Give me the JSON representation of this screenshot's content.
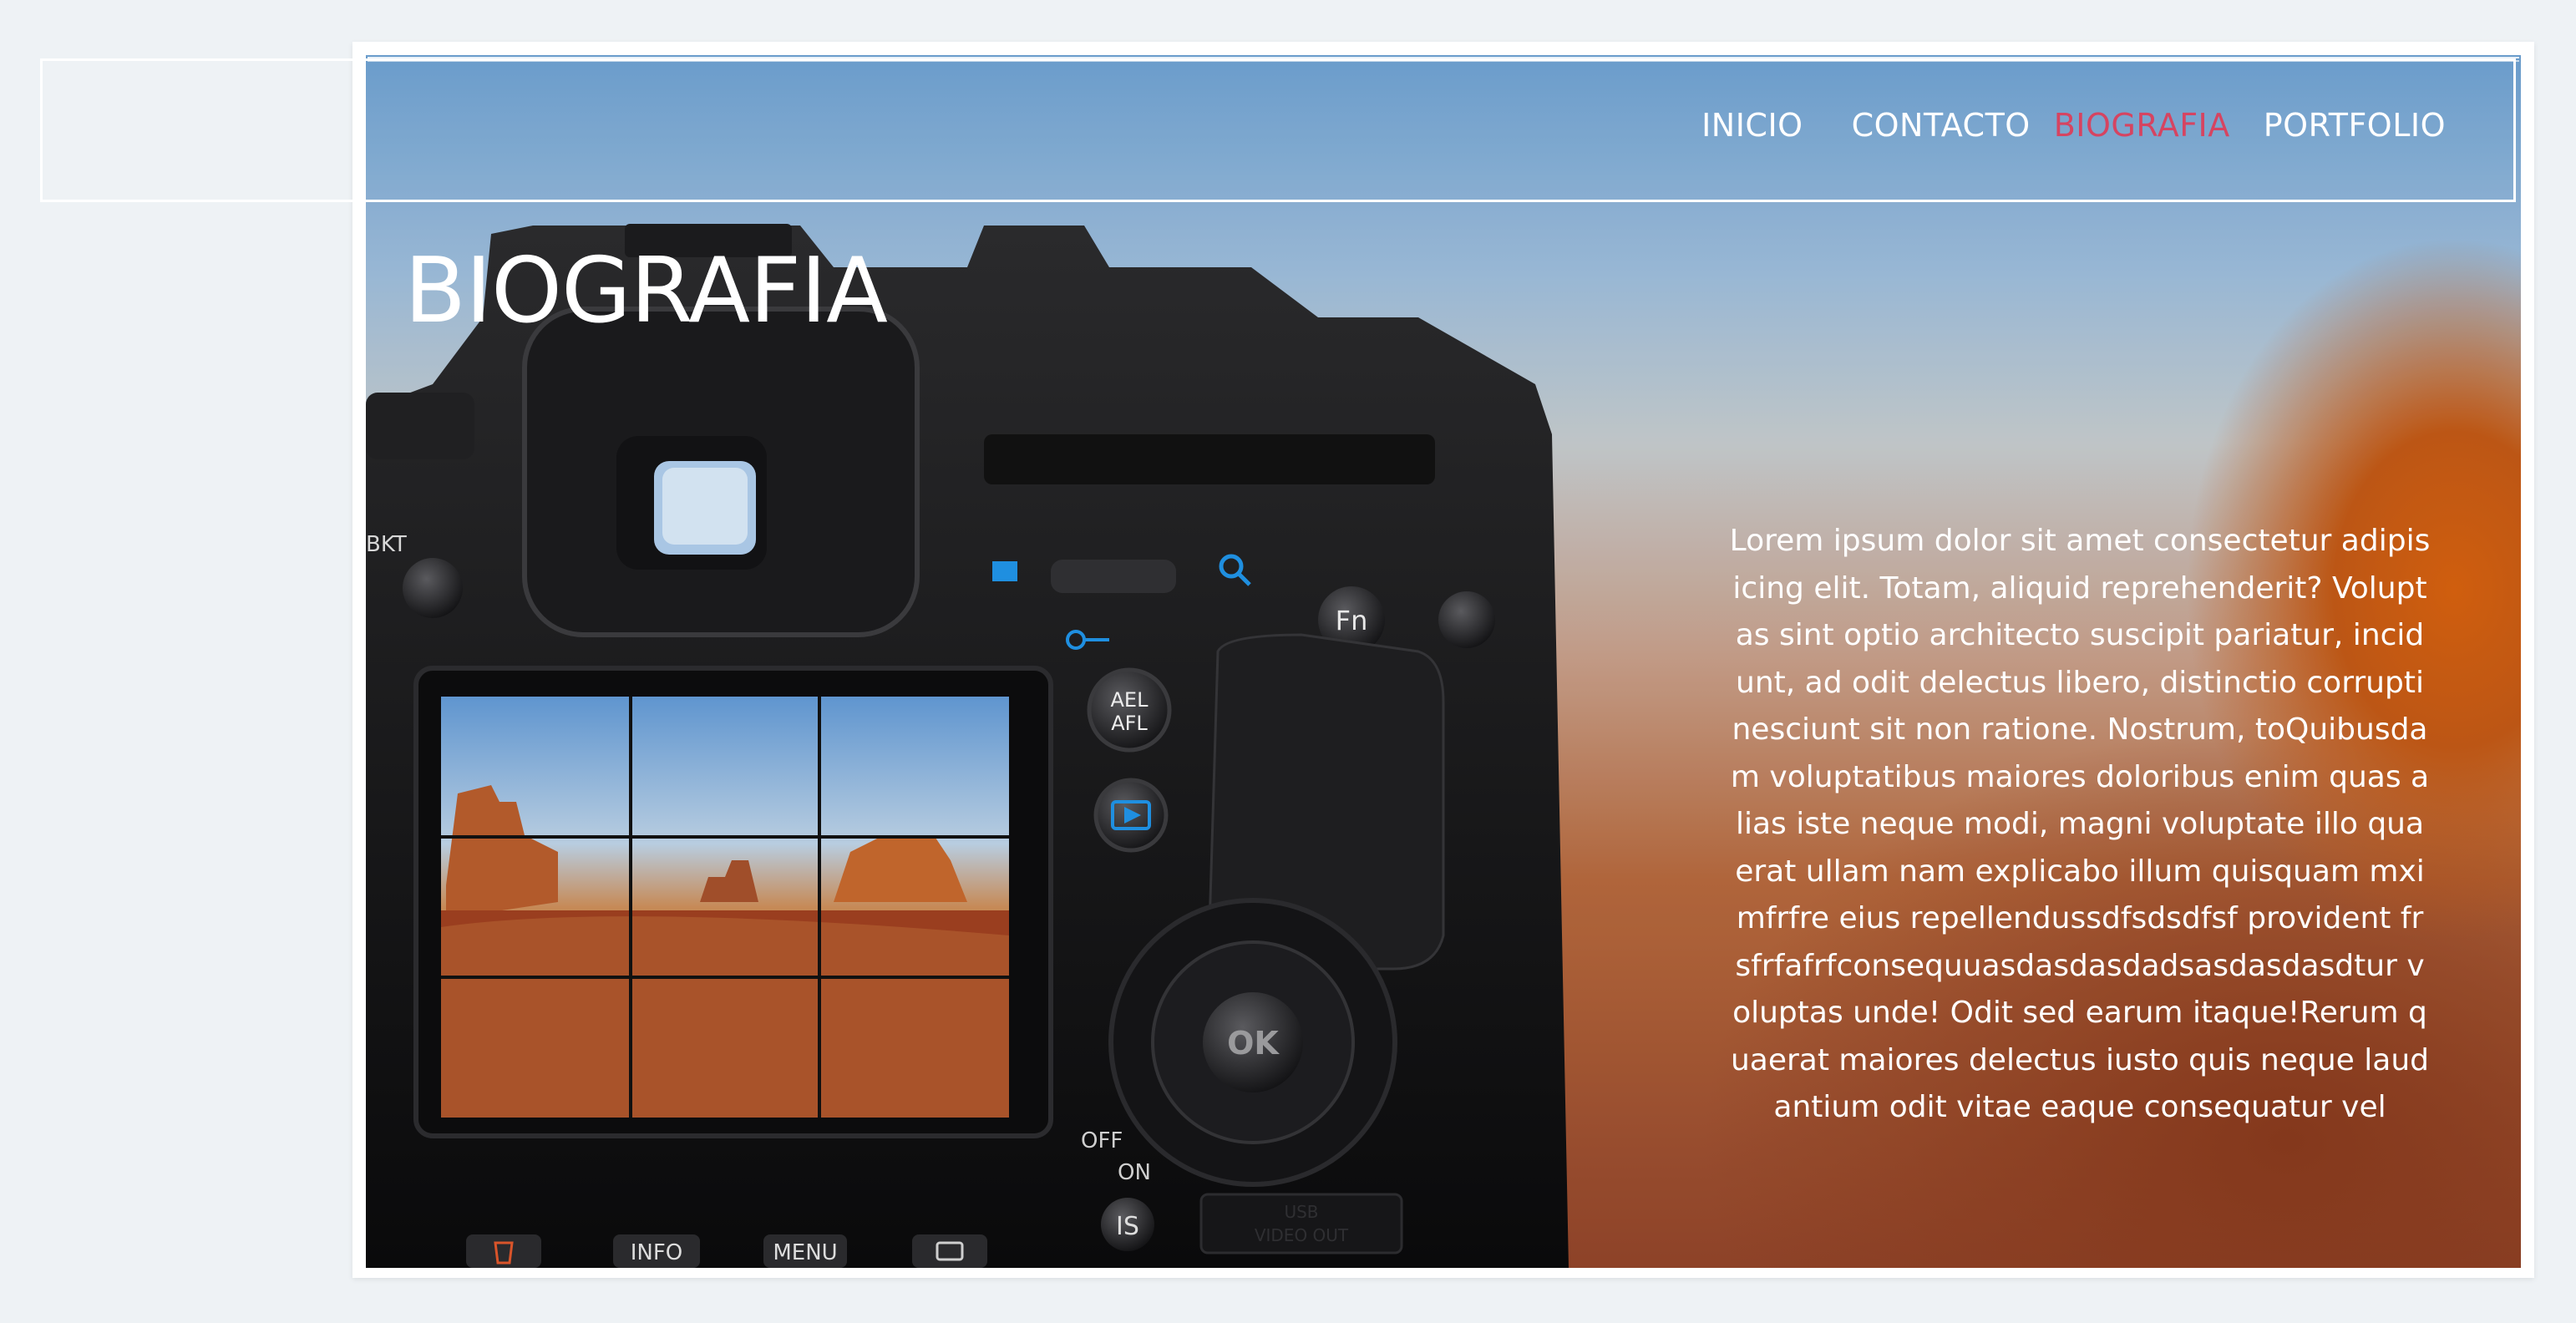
{
  "nav": {
    "items": [
      {
        "label": "INICIO",
        "active": false
      },
      {
        "label": "CONTACTO",
        "active": false
      },
      {
        "label": "BIOGRAFIA",
        "active": true
      },
      {
        "label": "PORTFOLIO",
        "active": false
      }
    ]
  },
  "page": {
    "title": "BIOGRAFIA",
    "body": "Lorem ipsum dolor sit amet consectetur adipisicing elit. Totam, aliquid reprehenderit? Voluptas sint optio architecto suscipit pariatur, incidunt, ad odit delectus libero, distinctio corrupti nesciunt sit non ratione. Nostrum, toQuibusdam voluptatibus maiores doloribus enim quas alias iste neque modi, magni voluptate illo quaerat ullam nam explicabo illum quisquam mximfrfre eius repellendussdfsdsdfsf provident frsfrfafrfconsequuasdasdasdadsasdasdasdtur voluptas unde! Odit sed earum itaque!Rerum quaerat maiores delectus iusto quis neque laudantium odit vitae eaque consequatur vel"
  },
  "camera": {
    "labels": {
      "bkt": "BKT",
      "fn": "Fn",
      "ael": "AEL",
      "afl": "AFL",
      "ok": "OK",
      "off": "OFF",
      "on": "ON",
      "is": "IS",
      "info": "INFO",
      "menu": "MENU",
      "usb": "USB",
      "video_out": "VIDEO OUT"
    }
  },
  "colors": {
    "accent": "#d64461",
    "text": "#ffffff",
    "page_bg": "#eef2f5"
  }
}
